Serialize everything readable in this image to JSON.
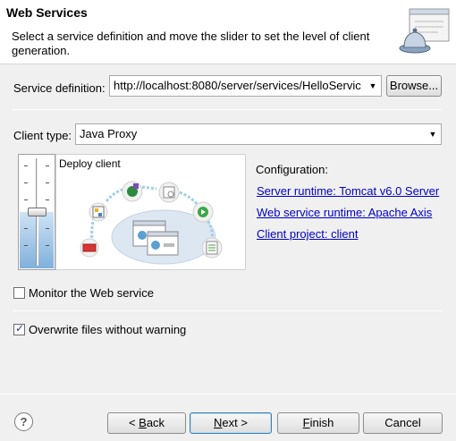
{
  "banner": {
    "title": "Web Services",
    "description": "Select a service definition and move the slider to set the level of client generation."
  },
  "service_definition": {
    "label": "Service definition:",
    "value": "http://localhost:8080/server/services/HelloServic",
    "browse_label": "Browse..."
  },
  "client_type": {
    "label": "Client type:",
    "value": "Java Proxy"
  },
  "slider": {
    "level_label": "Deploy client"
  },
  "configuration": {
    "heading": "Configuration:",
    "server_runtime": "Server runtime: Tomcat v6.0 Server",
    "ws_runtime": "Web service runtime: Apache Axis",
    "client_project": "Client project: client"
  },
  "options": {
    "monitor_label": "Monitor the Web service",
    "monitor_checked": false,
    "overwrite_label": "Overwrite files without warning",
    "overwrite_checked": true
  },
  "buttons": {
    "help": "?",
    "back_prefix": "< ",
    "back_mnemonic": "B",
    "back_rest": "ack",
    "next_mnemonic": "N",
    "next_rest": "ext >",
    "finish_mnemonic": "F",
    "finish_rest": "inish",
    "cancel": "Cancel"
  }
}
